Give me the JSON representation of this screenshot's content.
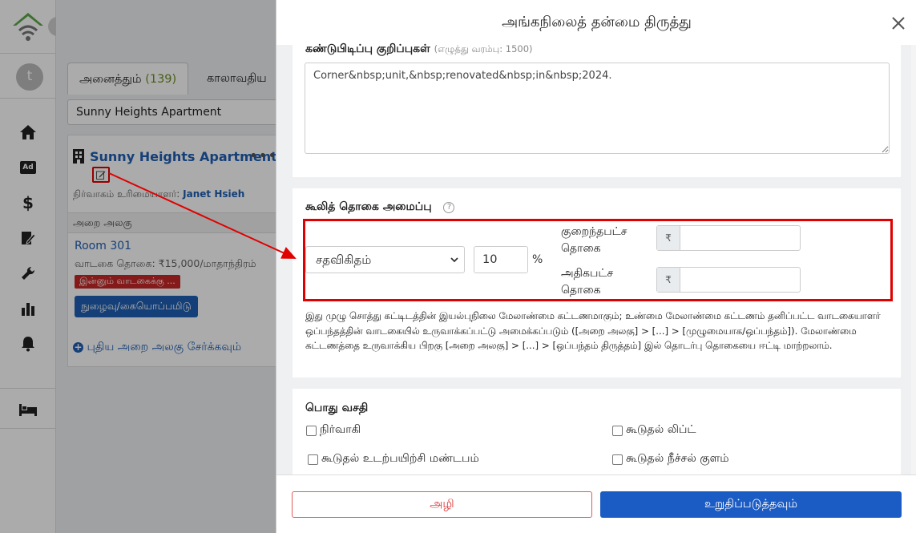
{
  "modal": {
    "title": "அங்கநிலைத் தன்மை திருத்து",
    "notes_title": "கண்டுபிடிப்பு குறிப்புகள்",
    "notes_hint": "(எழுத்து வரம்பு: 1500)",
    "notes_value": "Corner&nbsp;unit,&nbsp;renovated&nbsp;in&nbsp;2024.",
    "fee_title": "கூலித் தொகை அமைப்பு",
    "fee_type": "சதவிகிதம்",
    "fee_percent": "10",
    "percent_sign": "%",
    "min_label": "குறைந்தபட்ச தொகை",
    "max_label": "அதிகபட்ச தொகை",
    "currency": "₹",
    "fee_explanation": "இது முழு சொத்து கட்டிடத்தின் இயல்புநிலை மேலாண்மை கட்டணமாகும்; உண்மை மேலாண்மை கட்டணம் தனிப்பட்ட வாடகையாளர் ஒப்பந்தத்தின் வாடகையில் உருவாக்கப்பட்டு அமைக்கப்படும் ([அறை அலகு] > [...] > [முழுமையாக/ஒப்பந்தம்]). மேலாண்மை கட்டணத்தை உருவாக்கிய பிறகு [அறை அலகு] > [...] > [ஒப்பந்தம் திருத்தம்] இல் தொடர்பு தொகையை ஈட்டி மாற்றலாம்.",
    "amenities_title": "பொது வசதி",
    "amenities": [
      "நிர்வாகி",
      "கூடுதல் லிப்ட்",
      "கூடுதல் உடற்பயிற்சி மண்டபம்",
      "கூடுதல் நீச்சல் குளம்"
    ],
    "cancel_label": "அழி",
    "confirm_label": "உறுதிப்படுத்தவும்"
  },
  "background": {
    "avatar_letter": "t",
    "tab_all_label": "அனைத்தும்",
    "tab_all_count": "(139)",
    "tab_expiry_label": "காலாவதிய",
    "search_value": "Sunny Heights Apartment",
    "property_name": "Sunny Heights Apartment",
    "more_dots": "•••",
    "manager_label": "நிர்வாகம் உரிமையாளர்:",
    "manager_name": "Janet Hsieh",
    "unit_header": "அறை அலகு",
    "room_name": "Room 301",
    "rent_text": "வாடகை தொகை: ₹15,000/மாதாந்திரம்",
    "rent_badge": "இன்னும் வாடகைக்கு ...",
    "checkin_label": "நுழைவு/கையொப்பமிடு",
    "add_unit_label": "புதிய அறை அலகு சேர்க்கவும்",
    "nav_ad_label": "Ad"
  },
  "colors": {
    "accent": "#1a5bc4",
    "highlight": "#e00000",
    "danger": "#d33333",
    "logo_green": "#5ba84a"
  }
}
